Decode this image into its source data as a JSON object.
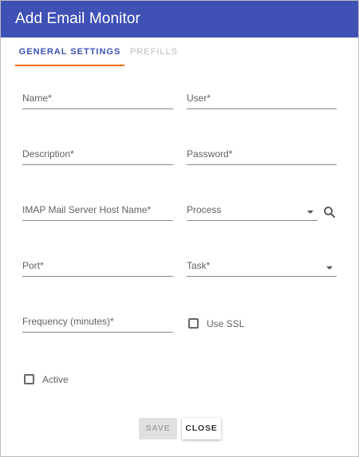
{
  "dialog": {
    "title": "Add Email Monitor"
  },
  "tabs": [
    {
      "label": "GENERAL SETTINGS",
      "active": true
    },
    {
      "label": "PREFILLS",
      "active": false
    }
  ],
  "fields": {
    "name": {
      "label": "Name*",
      "value": ""
    },
    "user": {
      "label": "User*",
      "value": ""
    },
    "description": {
      "label": "Description*",
      "value": ""
    },
    "password": {
      "label": "Password*",
      "value": ""
    },
    "imap_host": {
      "label": "IMAP Mail Server Host Name*",
      "value": ""
    },
    "process": {
      "label": "Process",
      "value": ""
    },
    "port": {
      "label": "Port*",
      "value": ""
    },
    "task": {
      "label": "Task*",
      "value": ""
    },
    "frequency": {
      "label": "Frequency (minutes)*",
      "value": ""
    }
  },
  "checkboxes": {
    "use_ssl": {
      "label": "Use SSL",
      "checked": false
    },
    "active": {
      "label": "Active",
      "checked": false
    }
  },
  "buttons": {
    "save": {
      "label": "SAVE",
      "disabled": true
    },
    "close": {
      "label": "CLOSE",
      "disabled": false
    }
  },
  "icons": {
    "process_search": "search-icon",
    "dropdown": "chevron-down-icon"
  },
  "colors": {
    "header": "#3f51b5",
    "tab_active": "#3f51b5",
    "tab_indicator": "#ef6c00",
    "tab_inactive": "#bdbdbd"
  }
}
